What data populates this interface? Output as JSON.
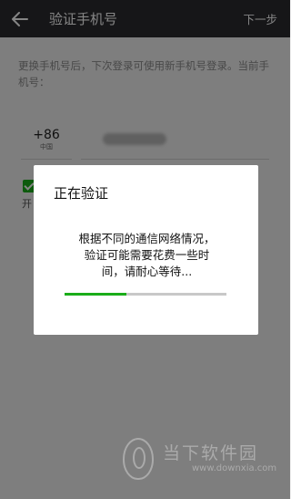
{
  "header": {
    "title": "验证手机号",
    "next_label": "下一步"
  },
  "main": {
    "hint": "更换手机号后，下次登录可使用新手机号登录。当前手机号：",
    "country_code": "+86",
    "country_name": "中国",
    "checkbox_label": "开",
    "checkbox_checked": true
  },
  "dialog": {
    "title": "正在验证",
    "message_lines": [
      "根据不同的通信网络情况，",
      "验证可能需要花费一些时",
      "间，请耐心等待..."
    ],
    "progress_fraction": 0.38
  },
  "watermark": {
    "name": "当下软件园",
    "url": "www.downxia.com"
  },
  "colors": {
    "topbar": "#2b2b2f",
    "accent_green": "#1aad19",
    "overlay": "rgba(0,0,0,0.48)"
  },
  "icons": {
    "back": "arrow-left-icon"
  }
}
